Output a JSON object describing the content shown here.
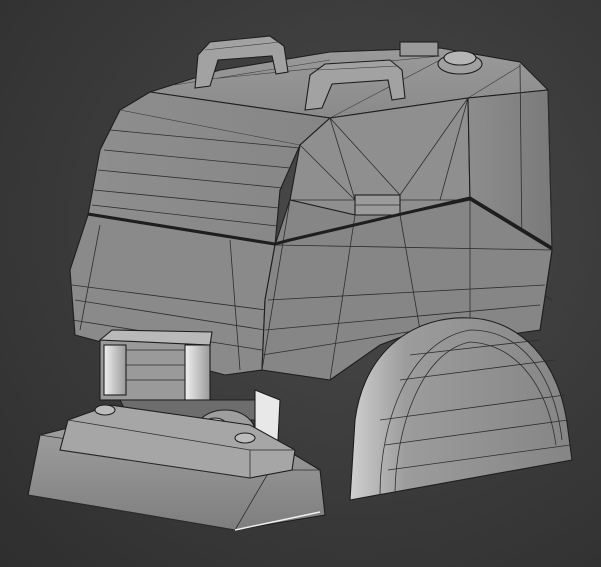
{
  "viewport": {
    "background_color": "#3a3a3a",
    "mesh_base_color": "#8c8c8c",
    "mesh_highlight_color": "#cfcfcf",
    "mesh_shadow_color": "#5a5a5a",
    "wire_color": "#2d2d2d"
  }
}
